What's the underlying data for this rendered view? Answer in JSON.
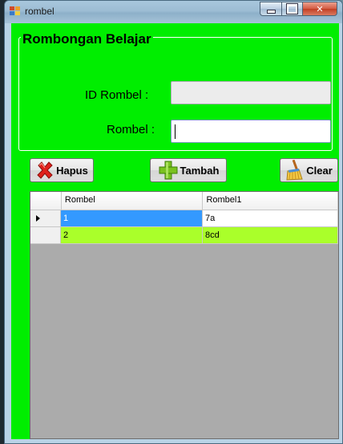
{
  "window": {
    "title": "rombel",
    "colors": {
      "client_bg": "#00ee00",
      "grid_bg": "#ababab",
      "selected_cell": "#3399ff",
      "alt_row": "#aaff2a"
    }
  },
  "group": {
    "title": "Rombongan Belajar",
    "id_label": "ID Rombel :",
    "id_value": "",
    "rombel_label": "Rombel :",
    "rombel_value": ""
  },
  "buttons": {
    "hapus": {
      "label": "Hapus",
      "icon": "delete-x-icon"
    },
    "tambah": {
      "label": "Tambah",
      "icon": "add-plus-icon"
    },
    "clear": {
      "label": "Clear",
      "icon": "broom-icon"
    }
  },
  "grid": {
    "columns": [
      "Rombel",
      "Rombel1"
    ],
    "rows": [
      {
        "c1": "1",
        "c2": "7a",
        "current": true
      },
      {
        "c1": "2",
        "c2": "8cd",
        "current": false
      }
    ]
  }
}
